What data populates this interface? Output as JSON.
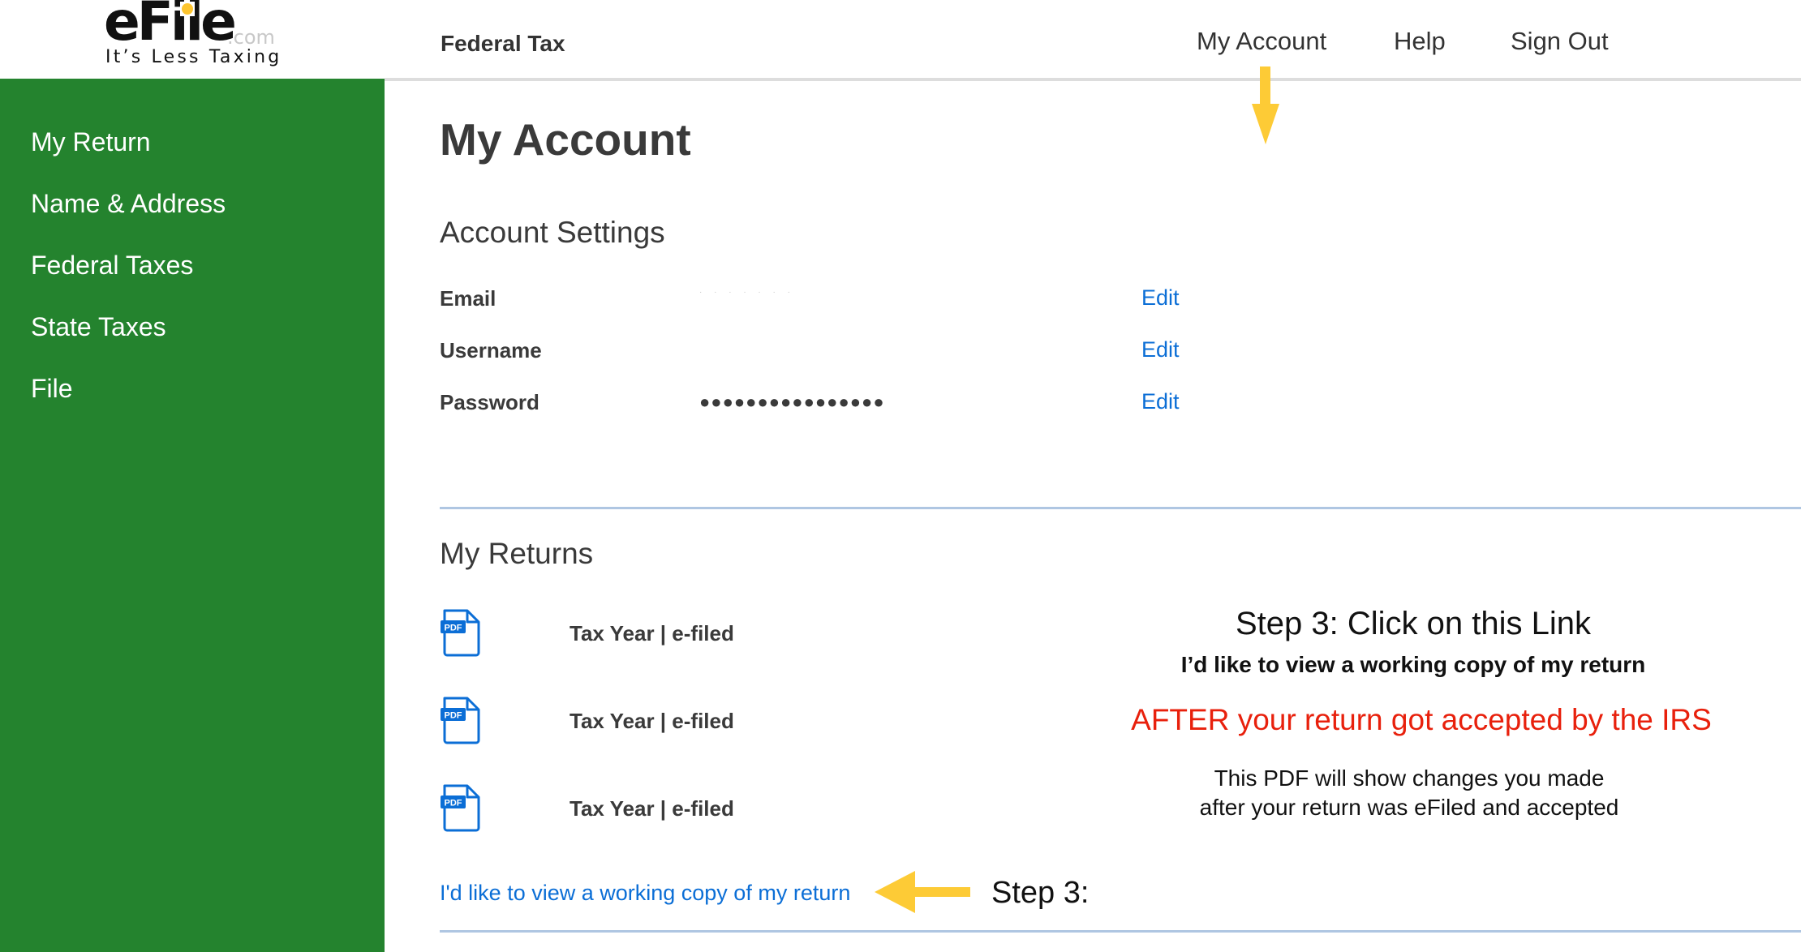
{
  "logo": {
    "brand": "eFile",
    "domain_suffix": ".com",
    "tagline": "It’s Less Taxing",
    "accent_color": "#FDC52F"
  },
  "header": {
    "product_title": "Federal Tax",
    "nav": [
      {
        "label": "My Account"
      },
      {
        "label": "Help"
      },
      {
        "label": "Sign Out"
      }
    ]
  },
  "sidebar": {
    "background_color": "#24832E",
    "items": [
      {
        "label": "My Return"
      },
      {
        "label": "Name & Address"
      },
      {
        "label": "Federal Taxes"
      },
      {
        "label": "State Taxes"
      },
      {
        "label": "File"
      }
    ]
  },
  "page": {
    "title": "My Account"
  },
  "account_settings": {
    "heading": "Account Settings",
    "rows": [
      {
        "label": "Email",
        "value": "· · · · · · ·",
        "redacted": true,
        "action": "Edit"
      },
      {
        "label": "Username",
        "value": "",
        "action": "Edit"
      },
      {
        "label": "Password",
        "value": "●●●●●●●●●●●●●●●●",
        "action": "Edit"
      }
    ]
  },
  "my_returns": {
    "heading": "My Returns",
    "items": [
      {
        "icon": "pdf-icon",
        "icon_label": "PDF",
        "text": "Tax Year | e-filed"
      },
      {
        "icon": "pdf-icon",
        "icon_label": "PDF",
        "text": "Tax Year | e-filed"
      },
      {
        "icon": "pdf-icon",
        "icon_label": "PDF",
        "text": "Tax Year | e-filed"
      }
    ],
    "working_copy_link": "I'd like to view a working copy of my return"
  },
  "annotation": {
    "title": "Step 3: Click on this Link",
    "link_name": "I’d like to view a working copy of my return",
    "condition": "AFTER your return got accepted by the IRS",
    "explanation_lines": [
      "This PDF will show changes you made",
      "after your return was eFiled and accepted"
    ],
    "step_label": "Step 3:",
    "arrow_color": "#FDCB36",
    "condition_color": "#E8200C"
  },
  "colors": {
    "link": "#0B6ED6",
    "divider": "#AFC6E2",
    "header_rule": "#DDDDDD"
  }
}
